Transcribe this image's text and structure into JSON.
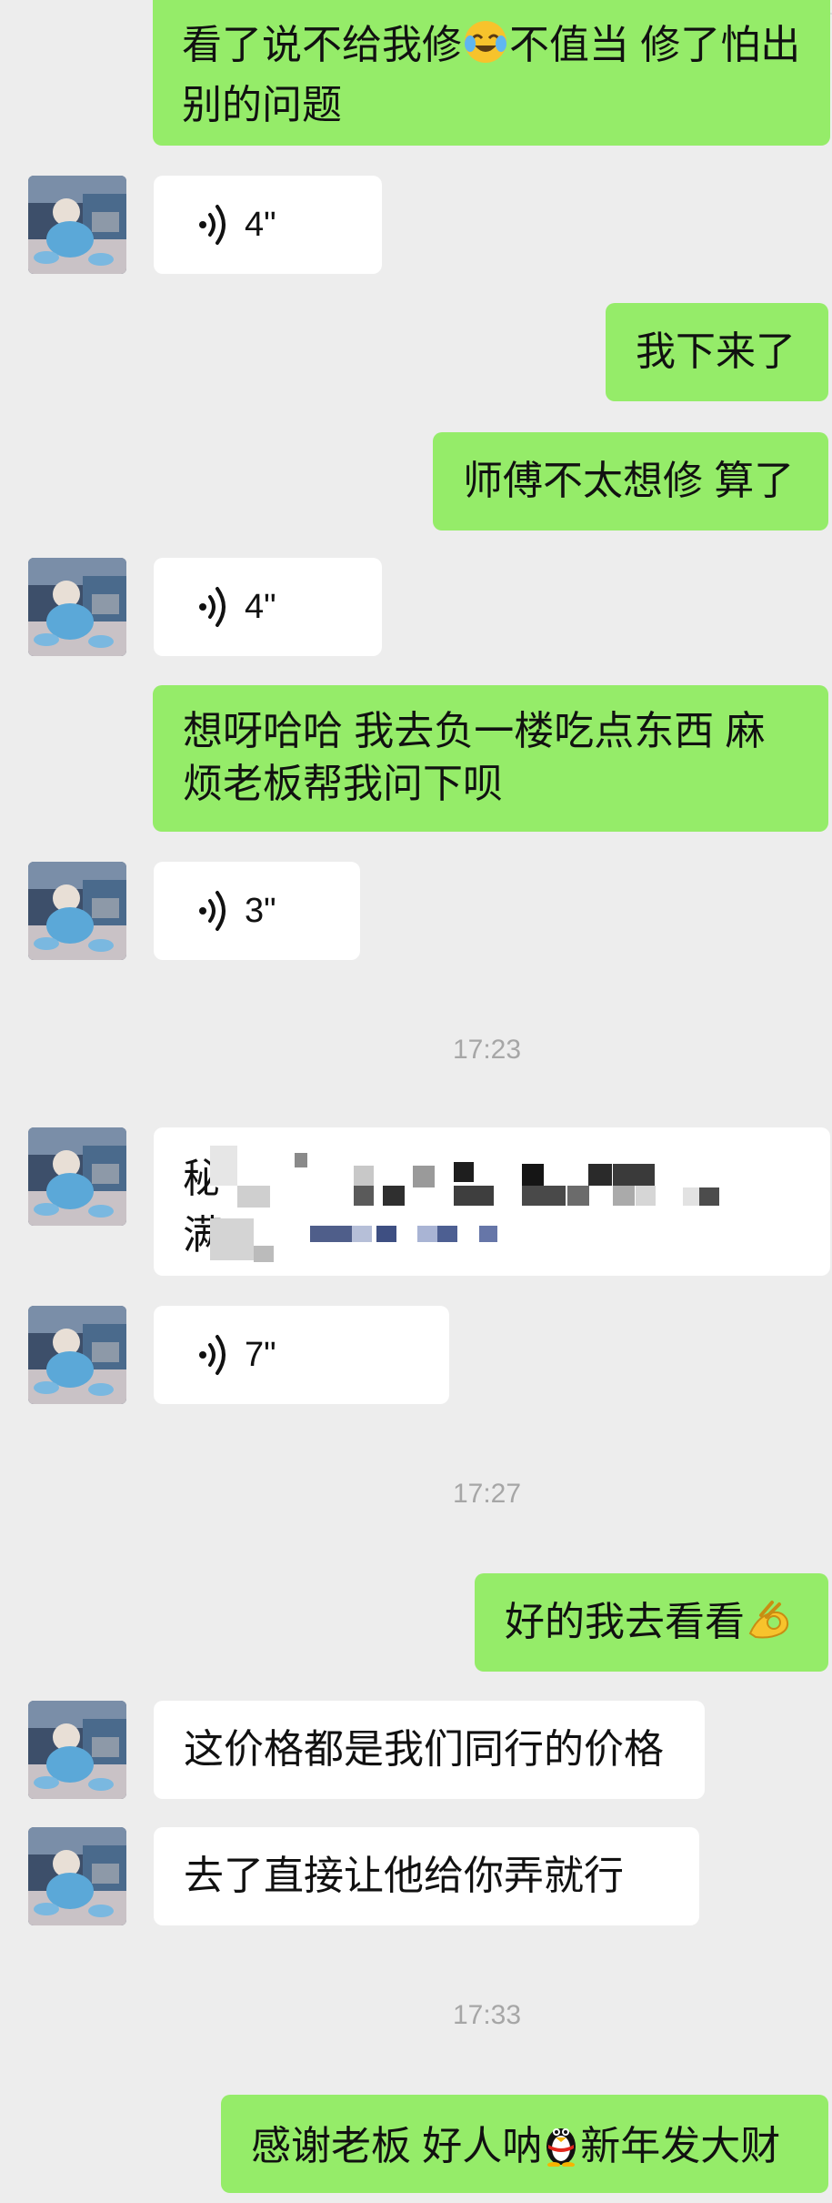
{
  "messages": {
    "m1": {
      "text_a": "看了说不给我修",
      "emoji": "crying-laughing-face-emoji",
      "text_b": "不值当 修了怕出",
      "text_c": "别的问题"
    },
    "v1": {
      "duration": "4\""
    },
    "m2": {
      "text": "我下来了"
    },
    "m3": {
      "text": "师傅不太想修 算了"
    },
    "v2": {
      "duration": "4\""
    },
    "m4": {
      "line1": "想呀哈哈  我去负一楼吃点东西 麻",
      "line2": "烦老板帮我问下呗"
    },
    "v3": {
      "duration": "3\""
    },
    "t1": {
      "time": "17:23"
    },
    "m5": {
      "char1": "秘",
      "char2": "满"
    },
    "v4": {
      "duration": "7\""
    },
    "t2": {
      "time": "17:27"
    },
    "m6": {
      "text": "好的我去看看",
      "emoji": "ok-hand-emoji"
    },
    "m7": {
      "text": "这价格都是我们同行的价格"
    },
    "m8": {
      "text": "去了直接让他给你弄就行"
    },
    "t3": {
      "time": "17:33"
    },
    "m9": {
      "text_a": "感谢老板 好人呐",
      "emoji": "qq-penguin-emoji",
      "text_b": "新年发大财"
    }
  },
  "colors": {
    "background": "#ededed",
    "sent_bubble": "#95ec69",
    "received_bubble": "#ffffff",
    "timestamp": "#a6a6a6"
  }
}
